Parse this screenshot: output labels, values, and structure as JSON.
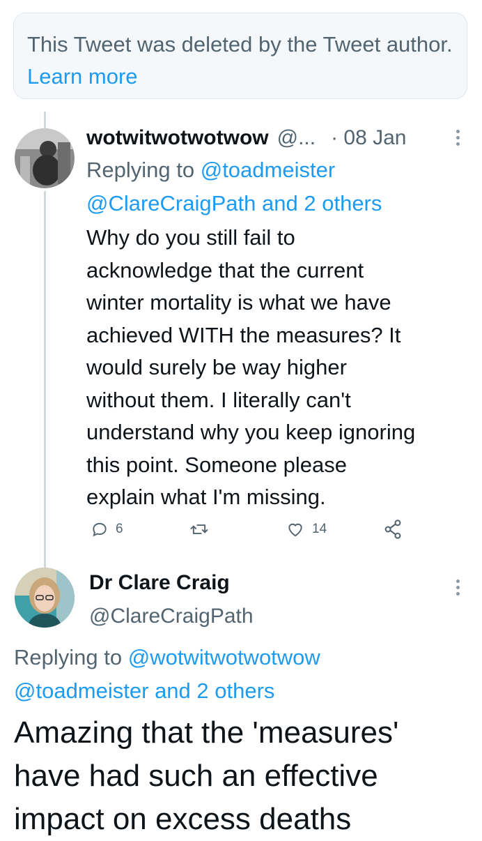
{
  "deleted_notice": {
    "text": "This Tweet was deleted by the Tweet author.",
    "learn_more": "Learn more"
  },
  "reply_tweet": {
    "display_name": "wotwitwotwotwow",
    "handle": "@...",
    "date": "· 08 Jan",
    "replying_label": "Replying to",
    "replying_user1": "@toadmeister",
    "replying_user2": "@ClareCraigPath",
    "replying_and": "and 2 others",
    "body_lines": [
      "Why do you still fail to",
      "acknowledge that the current",
      "winter mortality is what we have",
      "achieved WITH the measures? It",
      "would surely be way higher",
      "without them. I literally can't",
      "understand why you keep ignoring",
      "this point. Someone please",
      "explain what I'm missing."
    ],
    "reply_count": "6",
    "like_count": "14"
  },
  "main_tweet": {
    "display_name": "Dr Clare Craig",
    "handle": "@ClareCraigPath",
    "replying_label": "Replying to",
    "replying_user1": "@wotwitwotwotwow",
    "replying_user2": "@toadmeister",
    "replying_and": "and 2 others",
    "body_lines": [
      "Amazing that the 'measures'",
      "have had such an effective",
      "impact on excess deaths"
    ]
  },
  "colors": {
    "link": "#1d9bf0",
    "secondary": "#536471",
    "primary_text": "#0f1419",
    "thread_line": "#cfd9de"
  },
  "icons": [
    "reply-icon",
    "retweet-icon",
    "like-icon",
    "share-icon",
    "more-options-icon"
  ]
}
